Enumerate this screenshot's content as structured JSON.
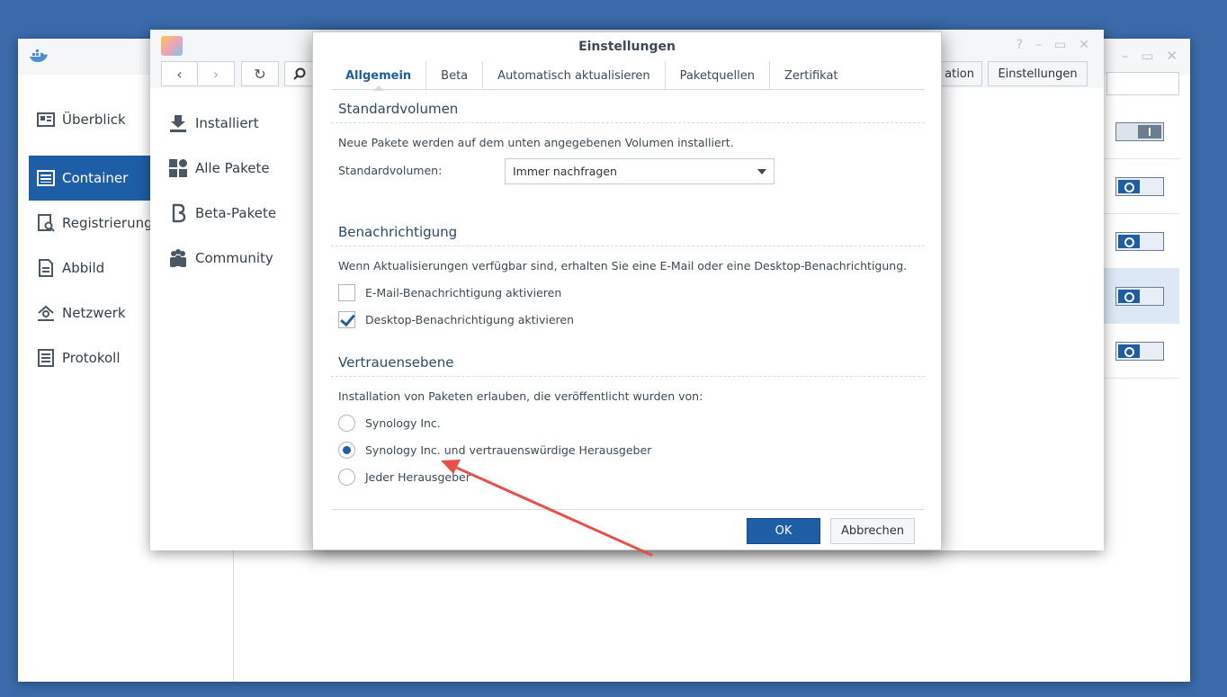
{
  "docker": {
    "sidebar": [
      {
        "label": "Überblick",
        "icon": "overview-icon"
      },
      {
        "label": "Container",
        "icon": "container-icon",
        "active": true
      },
      {
        "label": "Registrierung",
        "icon": "registry-icon"
      },
      {
        "label": "Abbild",
        "icon": "image-icon"
      },
      {
        "label": "Netzwerk",
        "icon": "network-icon"
      },
      {
        "label": "Protokoll",
        "icon": "log-icon"
      }
    ],
    "toolbar_partial_label": "ation",
    "toggles": [
      "off",
      "on",
      "on",
      "on",
      "on"
    ]
  },
  "package_center": {
    "sidebar": [
      {
        "label": "Installiert",
        "icon": "download-icon"
      },
      {
        "label": "Alle Pakete",
        "icon": "grid-icon"
      },
      {
        "label": "Beta-Pakete",
        "icon": "beta-icon"
      },
      {
        "label": "Community",
        "icon": "people-icon"
      }
    ],
    "settings_button": "Einstellungen",
    "partial_button": "ation"
  },
  "dialog": {
    "title": "Einstellungen",
    "tabs": [
      "Allgemein",
      "Beta",
      "Automatisch aktualisieren",
      "Paketquellen",
      "Zertifikat"
    ],
    "active_tab": "Allgemein",
    "standardvolumen": {
      "title": "Standardvolumen",
      "desc": "Neue Pakete werden auf dem unten angegebenen Volumen installiert.",
      "label": "Standardvolumen:",
      "value": "Immer nachfragen"
    },
    "benachrichtigung": {
      "title": "Benachrichtigung",
      "desc": "Wenn Aktualisierungen verfügbar sind, erhalten Sie eine E-Mail oder eine Desktop-Benachrichtigung.",
      "email_label": "E-Mail-Benachrichtigung aktivieren",
      "email_checked": false,
      "desktop_label": "Desktop-Benachrichtigung aktivieren",
      "desktop_checked": true
    },
    "vertrauensebene": {
      "title": "Vertrauensebene",
      "desc": "Installation von Paketen erlauben, die veröffentlicht wurden von:",
      "options": [
        "Synology Inc.",
        "Synology Inc. und vertrauenswürdige Herausgeber",
        "Jeder Herausgeber"
      ],
      "selected_index": 1
    },
    "ok_label": "OK",
    "cancel_label": "Abbrechen"
  },
  "colors": {
    "desktop": "#3a6aa9",
    "accent": "#1e5ea6",
    "annotation_arrow": "#e8504a"
  }
}
